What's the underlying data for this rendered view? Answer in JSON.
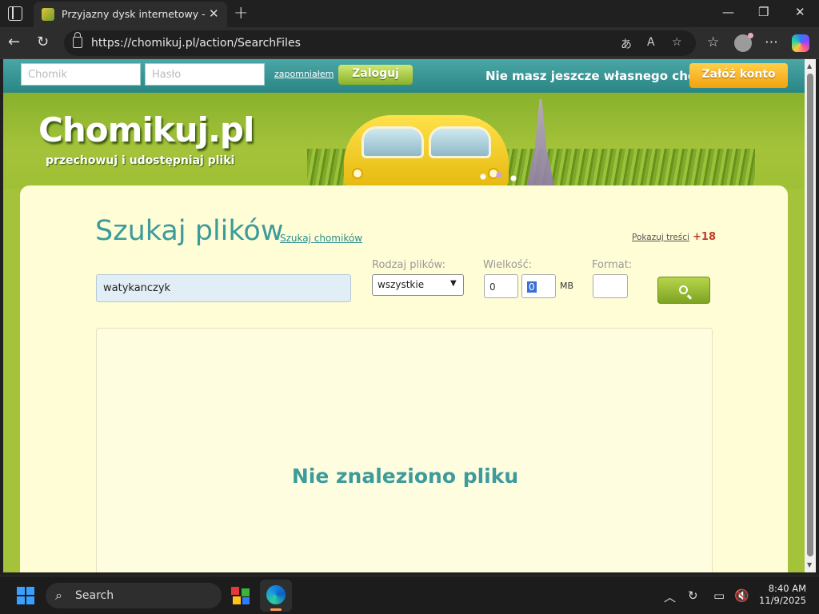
{
  "browser": {
    "tab_title": "Przyjazny dysk internetowy - Chomikuj.pl",
    "url": "https://chomikuj.pl/action/SearchFiles"
  },
  "loginbar": {
    "user_placeholder": "Chomik",
    "password_placeholder": "Hasło",
    "forgot_label": "zapomniałem",
    "login_label": "Zaloguj",
    "promo_text": "Nie masz jeszcze własnego chomika?",
    "register_label": "Załóż konto"
  },
  "header": {
    "logo": "Chomikuj.pl",
    "slogan": "przechowuj i udostępniaj pliki"
  },
  "search": {
    "title": "Szukaj plików",
    "search_hamsters_link": "Szukaj chomików",
    "show_content_link": "Pokazuj treści",
    "adult_badge": "+18",
    "query": "watykanczyk",
    "file_type_label": "Rodzaj plików:",
    "file_type_value": "wszystkie",
    "size_label": "Wielkość:",
    "size_min": "0",
    "size_max": "0",
    "size_unit": "MB",
    "format_label": "Format:",
    "format_value": ""
  },
  "results": {
    "message": "Nie znaleziono pliku"
  },
  "taskbar": {
    "search_label": "Search",
    "time": "8:40 AM",
    "date": "11/9/2025"
  }
}
